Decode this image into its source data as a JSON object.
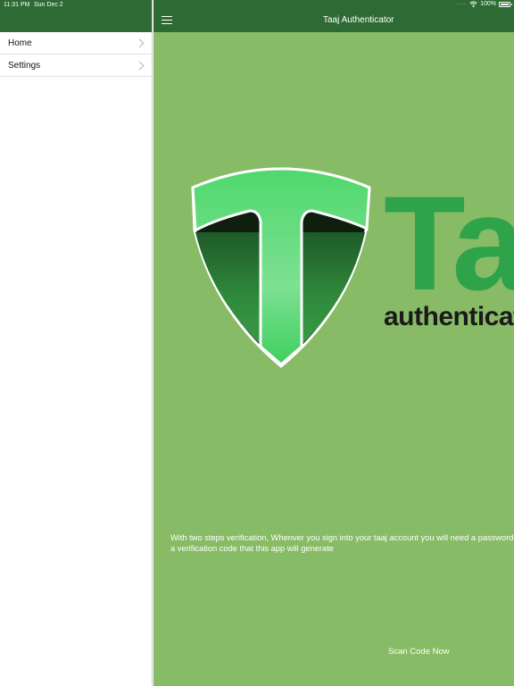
{
  "status_bar": {
    "time": "11:31 PM",
    "date": "Sun Dec 2",
    "battery": "100%",
    "wifi_icon": "wifi-icon",
    "battery_icon": "battery-icon"
  },
  "sidebar": {
    "items": [
      {
        "label": "Home",
        "icon": "chevron-right-icon"
      },
      {
        "label": "Settings",
        "icon": "chevron-right-icon"
      }
    ]
  },
  "navbar": {
    "title": "Taaj Authenticator",
    "menu_icon": "hamburger-menu-icon"
  },
  "brand": {
    "name": "Taaj",
    "subtitle": "authenticator"
  },
  "main": {
    "description": "With two steps verification, Whenver you sign into your taaj account you will need a password and a verification code that this app will generate",
    "scan_button": "Scan Code Now"
  },
  "colors": {
    "header": "#2e6b34",
    "background": "#87bb66",
    "brand_green": "#2fa34a",
    "shield_light": "#4fd86c",
    "shield_dark": "#2f8a3c"
  }
}
